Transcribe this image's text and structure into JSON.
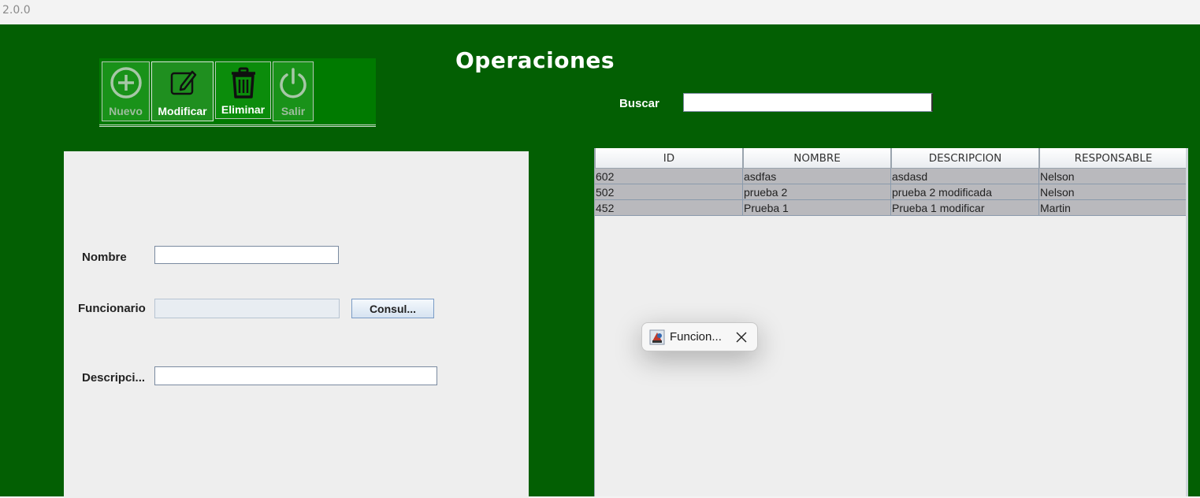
{
  "window": {
    "version": "2.0.0"
  },
  "page": {
    "title": "Operaciones"
  },
  "toolbar": {
    "buttons": [
      {
        "label": "Nuevo",
        "icon": "plus-circle-icon",
        "enabled": false
      },
      {
        "label": "Modificar",
        "icon": "edit-icon",
        "enabled": true
      },
      {
        "label": "Eliminar",
        "icon": "trash-icon",
        "enabled": true
      },
      {
        "label": "Salir",
        "icon": "power-icon",
        "enabled": false
      }
    ]
  },
  "search": {
    "label": "Buscar",
    "value": ""
  },
  "form": {
    "nombre_label": "Nombre",
    "nombre_value": "",
    "funcionario_label": "Funcionario",
    "funcionario_value": "",
    "consultar_label": "Consul...",
    "descripcion_label": "Descripci...",
    "descripcion_value": ""
  },
  "table": {
    "columns": [
      "ID",
      "NOMBRE",
      "DESCRIPCION",
      "RESPONSABLE"
    ],
    "rows": [
      [
        "602",
        "asdfas",
        "asdasd",
        "Nelson"
      ],
      [
        "502",
        "prueba 2",
        "prueba 2 modificada",
        "Nelson"
      ],
      [
        "452",
        "Prueba 1",
        "Prueba 1 modificar",
        "Martin"
      ]
    ]
  },
  "tooltip": {
    "text": "Funcion..."
  },
  "colors": {
    "background": "#035f03",
    "toolbar": "#007a00",
    "panel": "#eeeeee",
    "row": "#b9b9bd"
  }
}
